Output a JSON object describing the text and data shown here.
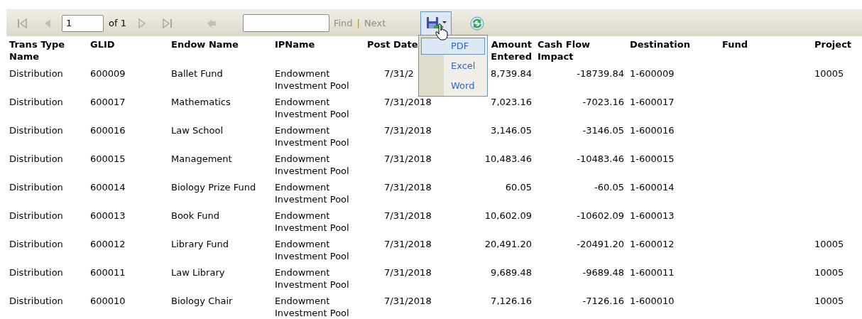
{
  "toolbar": {
    "page": "1",
    "page_of": "of 1",
    "find_label": "Find",
    "separator": "|",
    "next_label": "Next",
    "find_disabled": true,
    "nav_disabled": true,
    "export_open": true
  },
  "export_menu": [
    {
      "label": "PDF",
      "selected": true
    },
    {
      "label": "Excel",
      "selected": false
    },
    {
      "label": "Word",
      "selected": false
    }
  ],
  "table": {
    "columns": [
      "Trans Type Name",
      "GLID",
      "Endow Name",
      "IPName",
      "Post Date",
      "Amount Entered",
      "Cash Flow Impact",
      "Destination",
      "Fund",
      "Project"
    ],
    "rows": [
      [
        "Distribution",
        "600009",
        "Ballet Fund",
        "Endowment Investment Pool",
        "7/31/2",
        "8,739.84",
        "-18739.84",
        "1-600009",
        "",
        "10005"
      ],
      [
        "Distribution",
        "600017",
        "Mathematics",
        "Endowment Investment Pool",
        "7/31/2018",
        "7,023.16",
        "-7023.16",
        "1-600017",
        "",
        ""
      ],
      [
        "Distribution",
        "600016",
        "Law School",
        "Endowment Investment Pool",
        "7/31/2018",
        "3,146.05",
        "-3146.05",
        "1-600016",
        "",
        ""
      ],
      [
        "Distribution",
        "600015",
        "Management",
        "Endowment Investment Pool",
        "7/31/2018",
        "10,483.46",
        "-10483.46",
        "1-600015",
        "",
        ""
      ],
      [
        "Distribution",
        "600014",
        "Biology Prize Fund",
        "Endowment Investment Pool",
        "7/31/2018",
        "60.05",
        "-60.05",
        "1-600014",
        "",
        ""
      ],
      [
        "Distribution",
        "600013",
        "Book Fund",
        "Endowment Investment Pool",
        "7/31/2018",
        "10,602.09",
        "-10602.09",
        "1-600013",
        "",
        ""
      ],
      [
        "Distribution",
        "600012",
        "Library Fund",
        "Endowment Investment Pool",
        "7/31/2018",
        "20,491.20",
        "-20491.20",
        "1-600012",
        "",
        "10005"
      ],
      [
        "Distribution",
        "600011",
        "Law Library",
        "Endowment Investment Pool",
        "7/31/2018",
        "9,689.48",
        "-9689.48",
        "1-600011",
        "",
        "10005"
      ],
      [
        "Distribution",
        "600010",
        "Biology Chair",
        "Endowment Investment Pool",
        "7/31/2018",
        "7,126.16",
        "-7126.16",
        "1-600010",
        "",
        "10005"
      ]
    ]
  }
}
